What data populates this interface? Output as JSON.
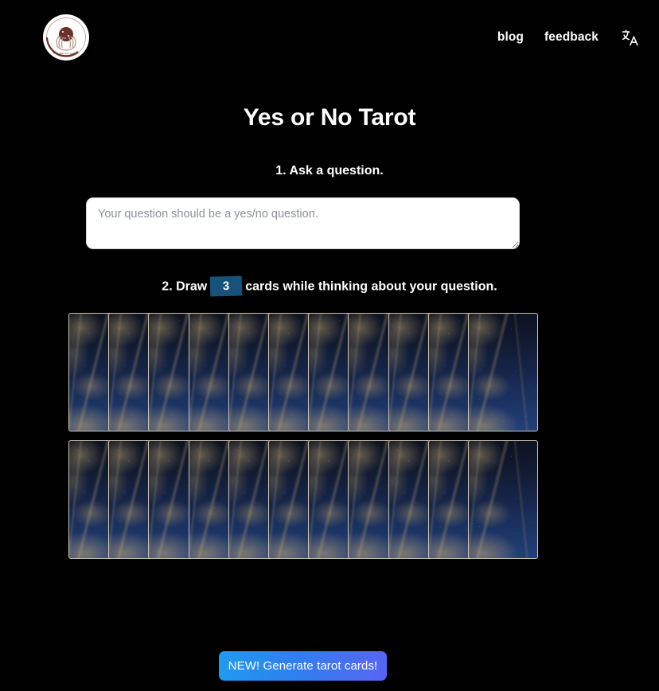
{
  "header": {
    "logo": {
      "name": "yes-no-tarot-logo",
      "caption": "YES OR NO TAROT",
      "sphere_color": "#6b3028",
      "badge_bg": "#ffffff"
    },
    "nav": [
      {
        "label": "blog",
        "name": "nav-link-blog"
      },
      {
        "label": "feedback",
        "name": "nav-link-feedback"
      }
    ],
    "language_icon": "translate-icon",
    "language_glyph": "文A"
  },
  "main": {
    "title": "Yes or No Tarot",
    "step1": {
      "label": "1. Ask a question.",
      "textarea_placeholder": "Your question should be a yes/no question.",
      "textarea_value": ""
    },
    "step2": {
      "prefix": "2. Draw",
      "count": "3",
      "suffix": "cards while thinking about your question.",
      "badge_color": "#16527a"
    },
    "deck": {
      "rows": 2,
      "cards_per_row": 11,
      "card_label": "tarot-card-back",
      "card_border_color": "#cfc6ae",
      "card_bg_top": "#0b1120",
      "card_bg_bottom": "#22407a"
    }
  },
  "footer": {
    "cta_label": "NEW! Generate tarot cards!",
    "cta_gradient_from": "#1f9bf0",
    "cta_gradient_to": "#5865f2"
  }
}
